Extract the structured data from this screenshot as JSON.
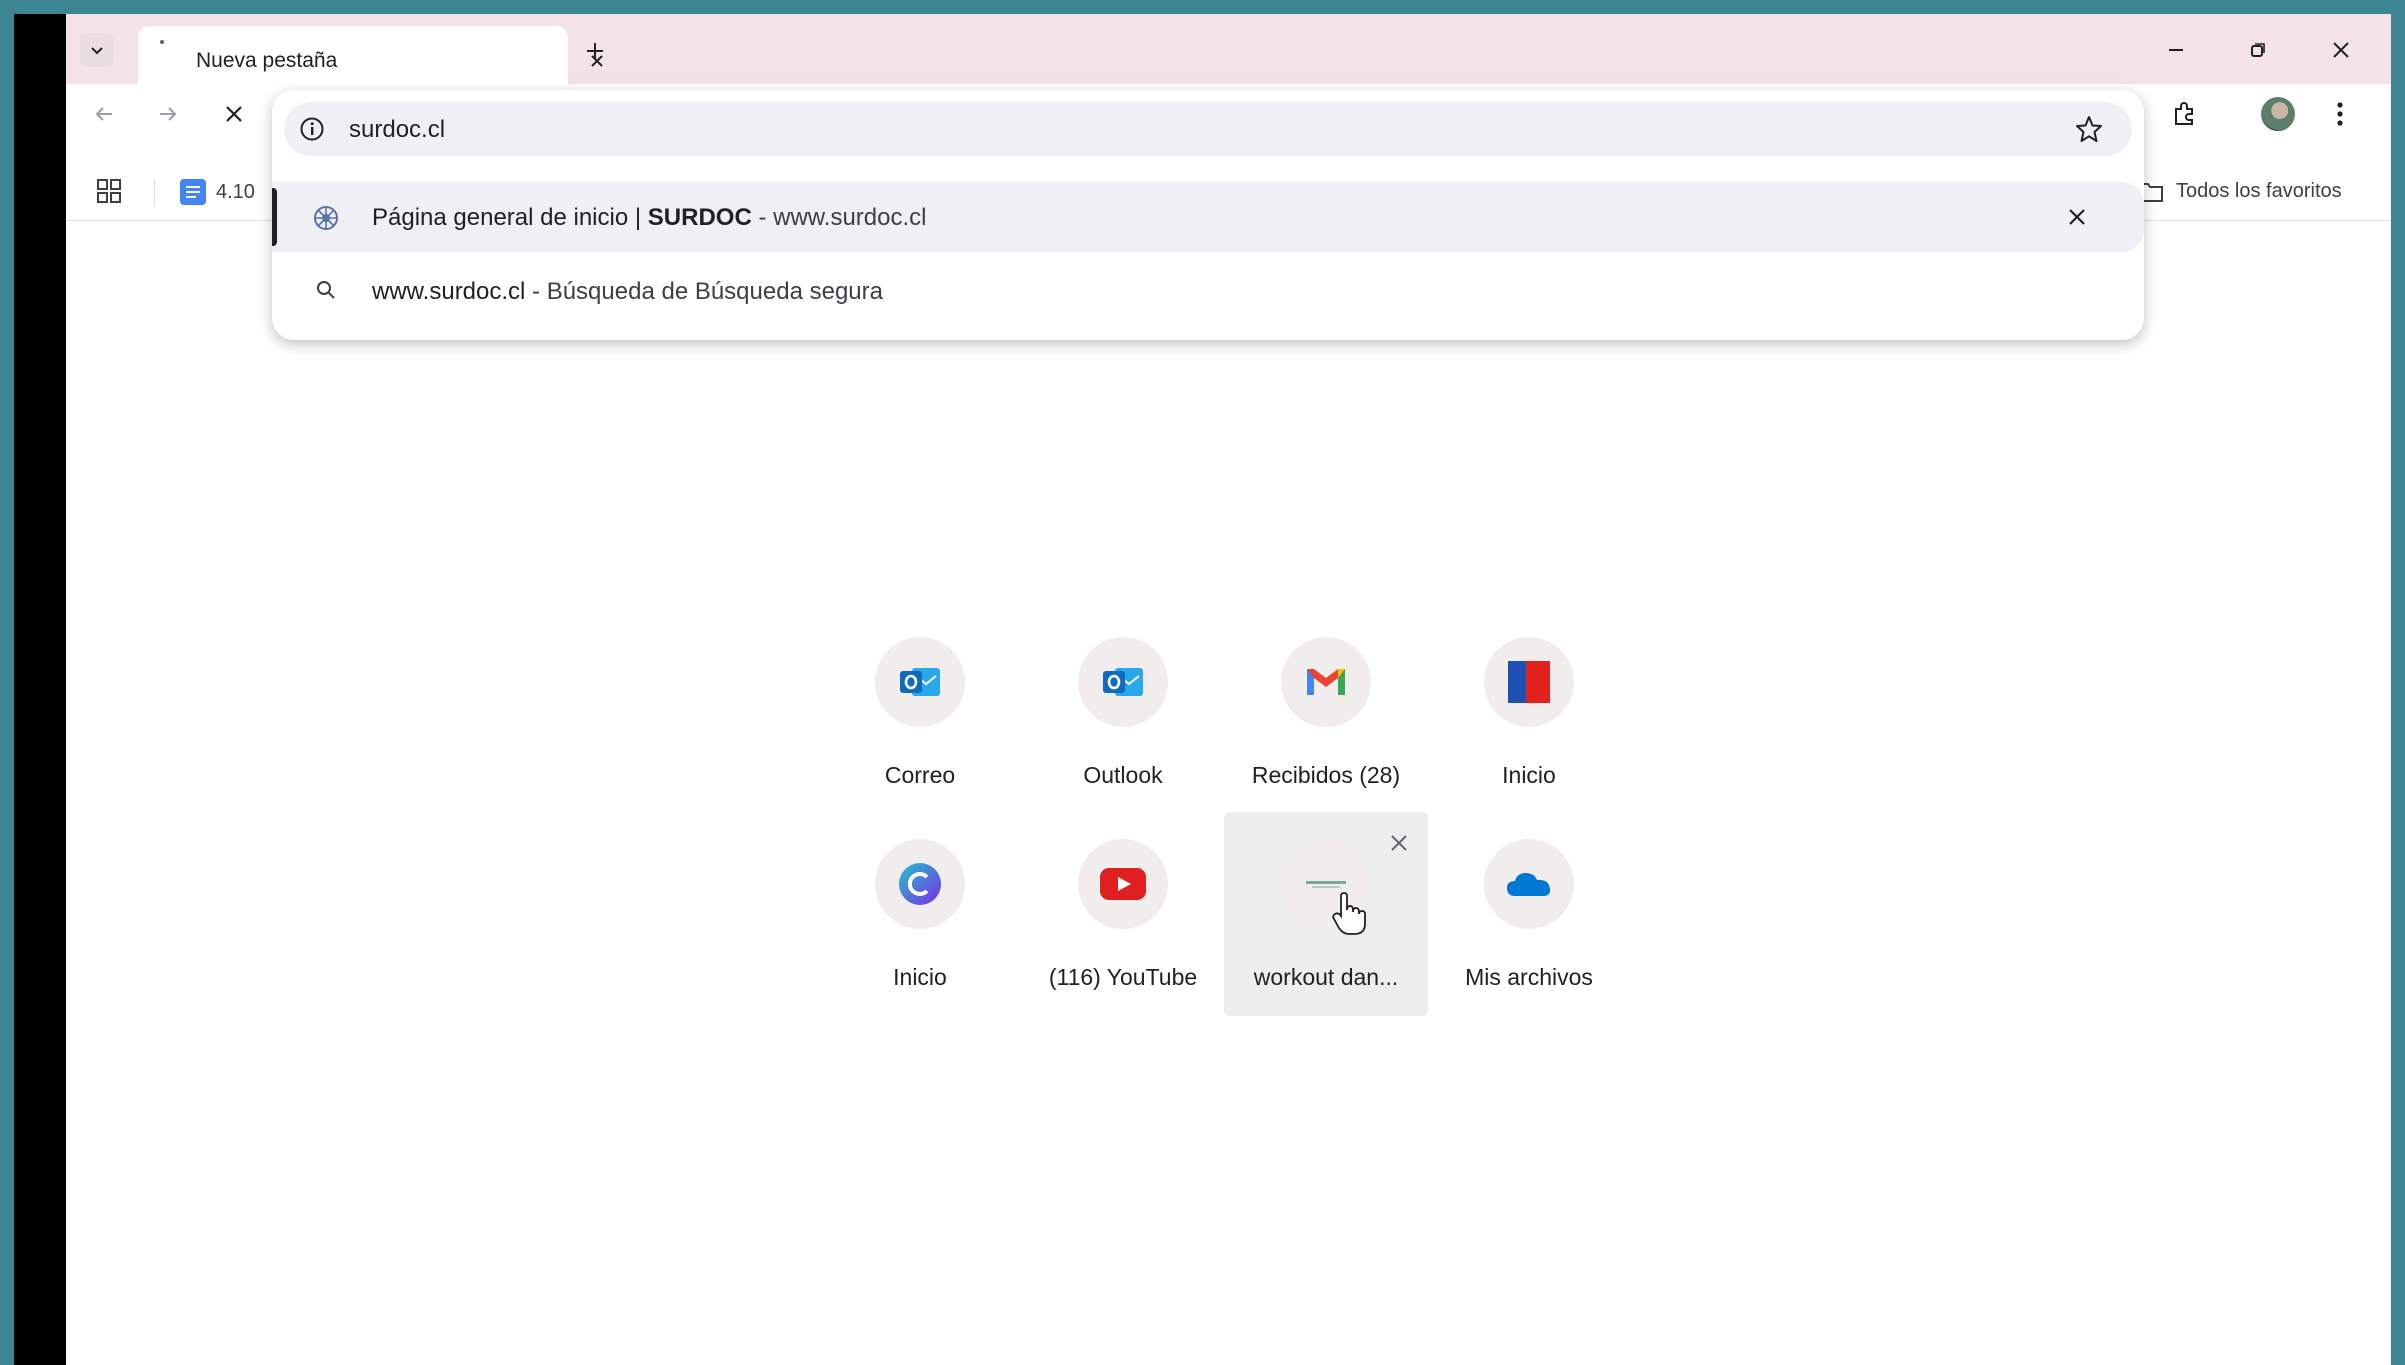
{
  "tabs": [
    {
      "title": "Nueva pestaña",
      "active": true
    }
  ],
  "window_controls": [
    "minimize",
    "restore",
    "close"
  ],
  "address_bar": {
    "value": "surdoc.cl"
  },
  "bookmarks": {
    "items": [
      {
        "label": "4.10",
        "icon": "docs-icon"
      }
    ],
    "all_bookmarks_label": "Todos los favoritos"
  },
  "omnibox_suggestions": [
    {
      "icon": "site-favicon",
      "title_prefix": "Página general de inicio | ",
      "title_bold": "SURDOC",
      "separator": " - ",
      "url": "www.surdoc.cl",
      "selected": true
    },
    {
      "icon": "search-icon",
      "query": "www.surdoc.cl",
      "separator": " - ",
      "engine": "Búsqueda de Búsqueda segura",
      "selected": false
    }
  ],
  "shortcuts": [
    {
      "label": "Correo",
      "icon": "outlook-icon"
    },
    {
      "label": "Outlook",
      "icon": "outlook-icon"
    },
    {
      "label": "Recibidos (28)",
      "icon": "gmail-icon"
    },
    {
      "label": "Inicio",
      "icon": "chile-flag-icon"
    },
    {
      "label": "Inicio",
      "icon": "canva-icon"
    },
    {
      "label": "(116) YouTube",
      "icon": "youtube-icon"
    },
    {
      "label": "workout dan...",
      "icon": "site-thumbnail-icon",
      "hovered": true
    },
    {
      "label": "Mis archivos",
      "icon": "onedrive-icon"
    }
  ],
  "colors": {
    "tabstrip": "#f3e3e7",
    "background_stripe": "#3d8592",
    "outlook_blue": "#0f6cbd",
    "youtube_red": "#e02020",
    "onedrive_blue": "#0078d4"
  }
}
